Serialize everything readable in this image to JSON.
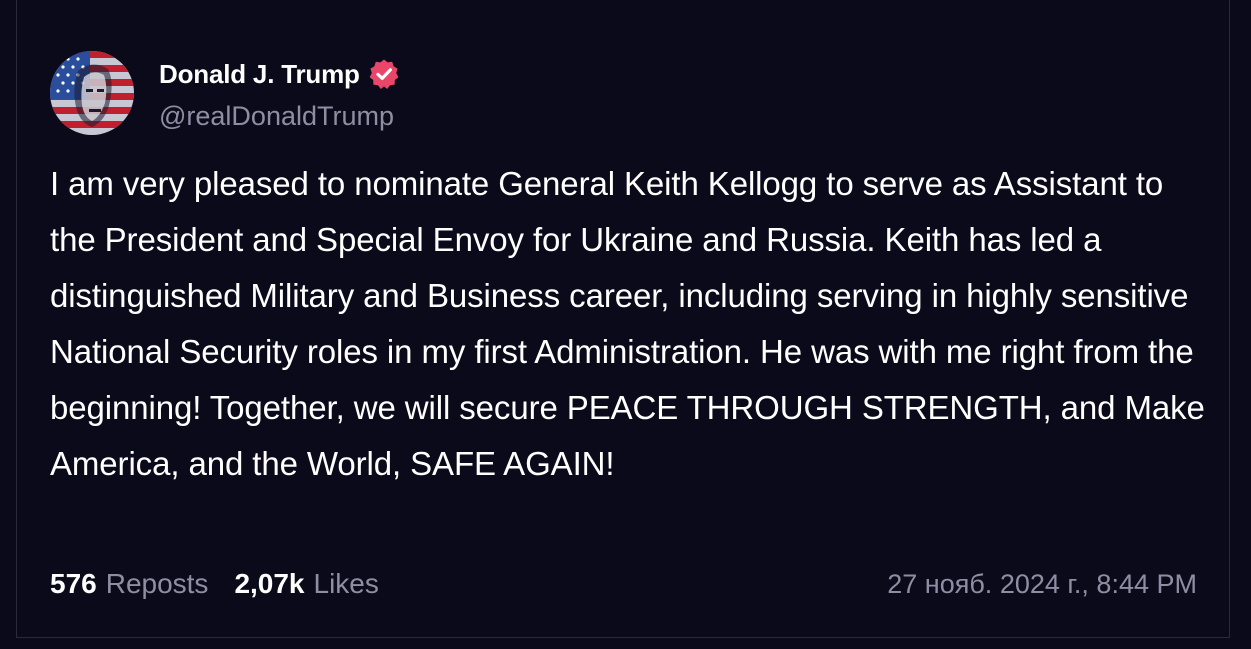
{
  "post": {
    "author_name": "Donald J. Trump",
    "author_handle": "@realDonaldTrump",
    "verified_icon": "verified-badge-icon",
    "body": "I am very pleased to nominate General Keith Kellogg to serve as Assistant to the President and Special Envoy for Ukraine and Russia. Keith has led a distinguished Military and Business career, including serving in highly sensitive National Security roles in my first Administration. He was with me right from the beginning! Together, we will secure PEACE THROUGH STRENGTH, and Make America, and the World, SAFE AGAIN!",
    "reposts_count": "576",
    "reposts_label": "Reposts",
    "likes_count": "2,07k",
    "likes_label": "Likes",
    "timestamp": "27 нояб. 2024 г., 8:44 PM"
  },
  "colors": {
    "background": "#0b0a1a",
    "verified_badge": "#e8476a",
    "muted_text": "#8e8ea3",
    "primary_text": "#ffffff"
  }
}
